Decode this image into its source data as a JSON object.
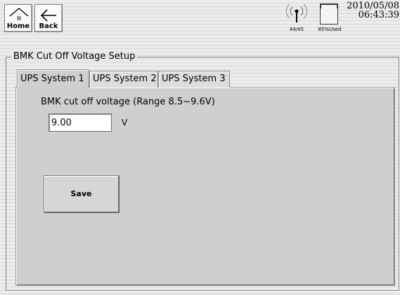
{
  "topbar": {
    "home_label": "Home",
    "back_label": "Back",
    "signal_text": "44/45",
    "storage_text": "85%Used",
    "date": "2010/05/08",
    "time": "06:43:39"
  },
  "group": {
    "title": "BMK Cut Off Voltage Setup"
  },
  "tabs": [
    {
      "label": "UPS System 1",
      "active": true
    },
    {
      "label": "UPS System 2",
      "active": false
    },
    {
      "label": "UPS System 3",
      "active": false
    }
  ],
  "form": {
    "field_label": "BMK cut off voltage (Range 8.5~9.6V)",
    "value": "9.00",
    "unit": "V",
    "save_label": "Save"
  }
}
